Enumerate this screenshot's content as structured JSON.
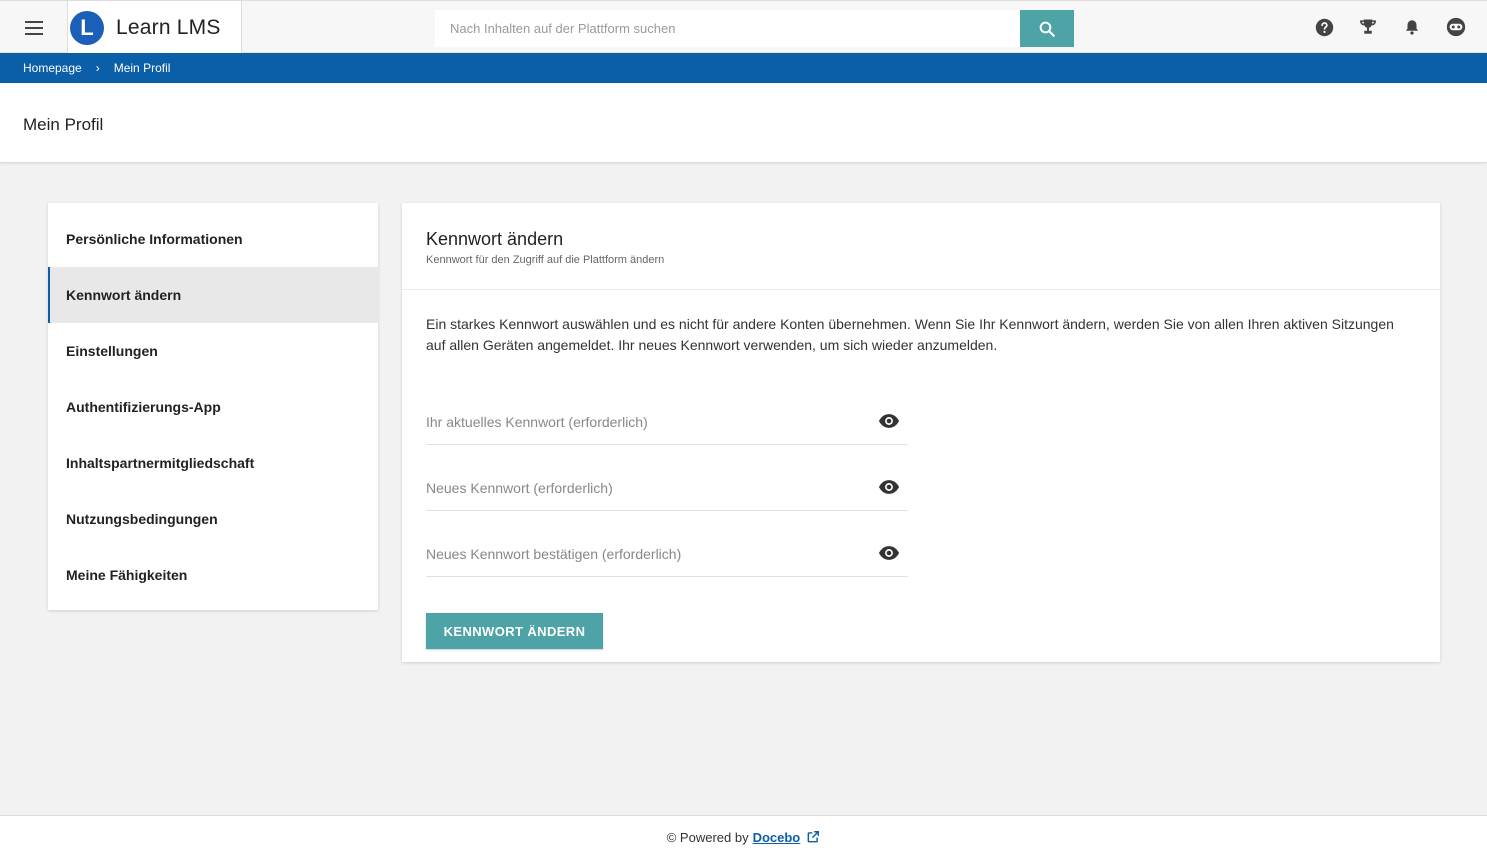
{
  "app": {
    "name": "Learn LMS",
    "logo_letter": "L"
  },
  "search": {
    "placeholder": "Nach Inhalten auf der Plattform suchen"
  },
  "breadcrumb": {
    "items": [
      "Homepage",
      "Mein Profil"
    ],
    "separator": "›"
  },
  "page": {
    "title": "Mein Profil"
  },
  "sidebar": {
    "items": [
      {
        "label": "Persönliche Informationen"
      },
      {
        "label": "Kennwort ändern",
        "active": true
      },
      {
        "label": "Einstellungen"
      },
      {
        "label": "Authentifizierungs-App"
      },
      {
        "label": "Inhaltspartnermitgliedschaft"
      },
      {
        "label": "Nutzungsbedingungen"
      },
      {
        "label": "Meine Fähigkeiten"
      }
    ]
  },
  "panel": {
    "title": "Kennwort ändern",
    "subtitle": "Kennwort für den Zugriff auf die Plattform ändern",
    "description": "Ein starkes Kennwort auswählen und es nicht für andere Konten übernehmen. Wenn Sie Ihr Kennwort ändern, werden Sie von allen Ihren aktiven Sitzungen auf allen Geräten angemeldet. Ihr neues Kennwort verwenden, um sich wieder anzumelden.",
    "fields": [
      {
        "placeholder": "Ihr aktuelles Kennwort (erforderlich)",
        "value": ""
      },
      {
        "placeholder": "Neues Kennwort (erforderlich)",
        "value": ""
      },
      {
        "placeholder": "Neues Kennwort bestätigen (erforderlich)",
        "value": ""
      }
    ],
    "submit_label": "KENNWORT ÄNDERN"
  },
  "footer": {
    "prefix": "© Powered by",
    "brand": "Docebo"
  },
  "colors": {
    "primary_blue": "#0b5ea8",
    "accent_teal": "#4ea3a6"
  },
  "icons": [
    "hamburger-menu-icon",
    "search-icon",
    "help-icon",
    "trophy-icon",
    "bell-icon",
    "avatar-icon",
    "eye-icon",
    "external-link-icon"
  ]
}
